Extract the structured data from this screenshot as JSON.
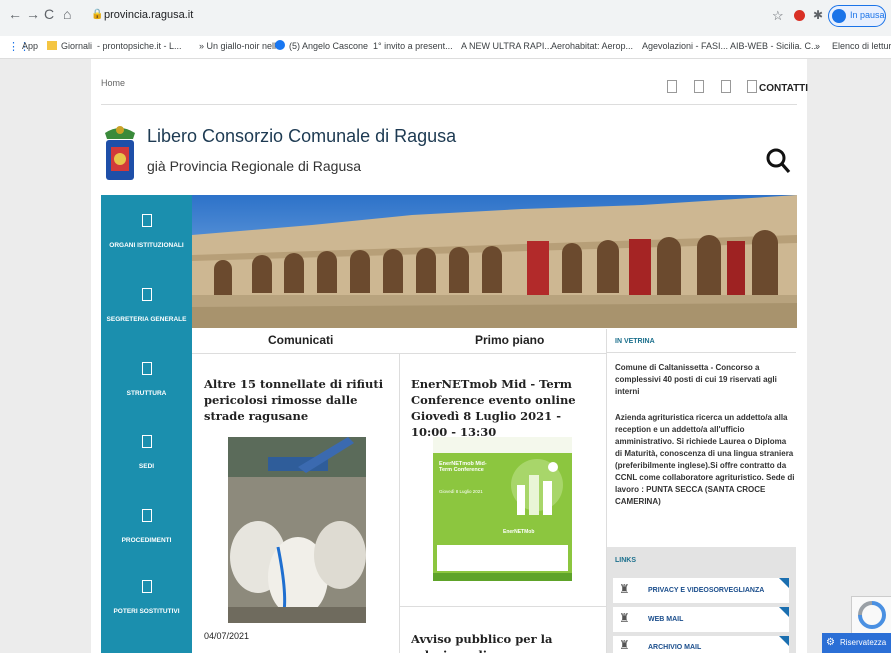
{
  "browser": {
    "url": "provincia.ragusa.it",
    "profile_label": "In pausa",
    "nav": {
      "back": "←",
      "forward": "→",
      "reload": "C",
      "home": "⌂"
    },
    "bookmarks": [
      "App",
      "Giornali",
      "- prontopsiche.it - L...",
      "» Un giallo-noir nell...",
      "(5) Angelo Cascone",
      "1° invito a present...",
      "A NEW ULTRA RAPI...",
      "Aerohabitat: Aerop...",
      "Agevolazioni - FASI...",
      "AIB-WEB - Sicilia. C...",
      "»",
      "Elenco di lettura"
    ]
  },
  "header": {
    "breadcrumb": "Home",
    "contact_label": "CONTATTI",
    "title": "Libero Consorzio Comunale di Ragusa",
    "subtitle": "già Provincia Regionale di Ragusa",
    "search_icon": "search-icon"
  },
  "sidebar": {
    "items": [
      {
        "label": "ORGANI ISTITUZIONALI"
      },
      {
        "label": "SEGRETERIA GENERALE"
      },
      {
        "label": "STRUTTURA"
      },
      {
        "label": "SEDI"
      },
      {
        "label": "PROCEDIMENTI"
      },
      {
        "label": "POTERI SOSTITUTIVI"
      }
    ]
  },
  "tabs": {
    "comunicati": "Comunicati",
    "primo_piano": "Primo piano"
  },
  "news": {
    "comunicato_title": "Altre 15 tonnellate di rifiuti pericolosi rimosse dalle strade ragusane",
    "comunicato_date": "04/07/2021",
    "primo_title": "EnerNETmob Mid - Term Conference evento online Giovedì 8 Luglio 2021 - 10:00 - 13:30",
    "poster": {
      "heading": "EnerNETmob Mid-Term Conference",
      "date": "Giovedì 8 Luglio 2021",
      "side_label": "EnerNETMob"
    },
    "avviso_title": "Avviso pubblico per la selezione di"
  },
  "vetrina": {
    "heading": "IN VETRINA",
    "item1": "Comune di Caltanissetta - Concorso a complessivi 40 posti di cui 19 riservati agli interni",
    "item2": "Azienda agrituristica ricerca un addetto/a alla reception e un addetto/a all'ufficio amministrativo. Si richiede Laurea o Diploma di Maturità, conoscenza di una lingua straniera (preferibilmente inglese).Si offre contratto da CCNL come collaboratore agrituristico. Sede di lavoro : PUNTA SECCA (SANTA CROCE CAMERINA)"
  },
  "links": {
    "heading": "LINKS",
    "items": [
      {
        "label": "PRIVACY E VIDEOSORVEGLIANZA"
      },
      {
        "label": "WEB MAIL"
      },
      {
        "label": "ARCHIVIO MAIL"
      }
    ]
  },
  "cookie": {
    "label": "Riservatezza"
  },
  "colors": {
    "sidebar": "#1b8fae",
    "title": "#1d3a52",
    "accent_link": "#1b4e8c"
  }
}
